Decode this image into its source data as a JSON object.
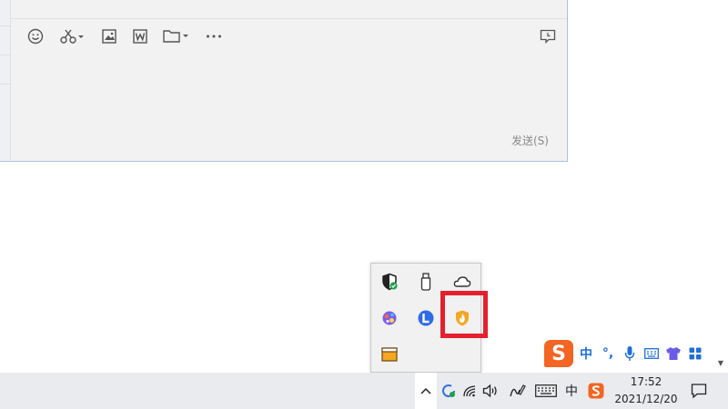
{
  "chat": {
    "send_label": "发送(S)",
    "toolbar_icons": [
      "emoji-icon",
      "scissors-icon",
      "image-icon",
      "word-doc-icon",
      "folder-icon",
      "more-icon",
      "chat-history-icon"
    ]
  },
  "tray_popup": {
    "icons": [
      "security-shield-icon",
      "usb-drive-icon",
      "onedrive-cloud-icon",
      "paint-app-icon",
      "blue-l-app-icon",
      "flame-app-icon",
      "window-app-icon"
    ],
    "highlighted": "flame-app-icon",
    "highlight_color": "#e5202e"
  },
  "ime": {
    "logo": "S",
    "mode": "中",
    "punct": "°,",
    "icons": [
      "mic-icon",
      "keyboard-icon",
      "shirt-icon",
      "grid-icon"
    ],
    "brand_color": "#f26522"
  },
  "taskbar": {
    "ime_char": "中",
    "time": "17:52",
    "date": "2021/12/20",
    "icons": [
      "chevron-up-icon",
      "refresh-app-icon",
      "wifi-icon",
      "volume-icon",
      "pen-icon",
      "touch-keyboard-icon",
      "sogou-tray-icon",
      "notification-icon"
    ]
  }
}
